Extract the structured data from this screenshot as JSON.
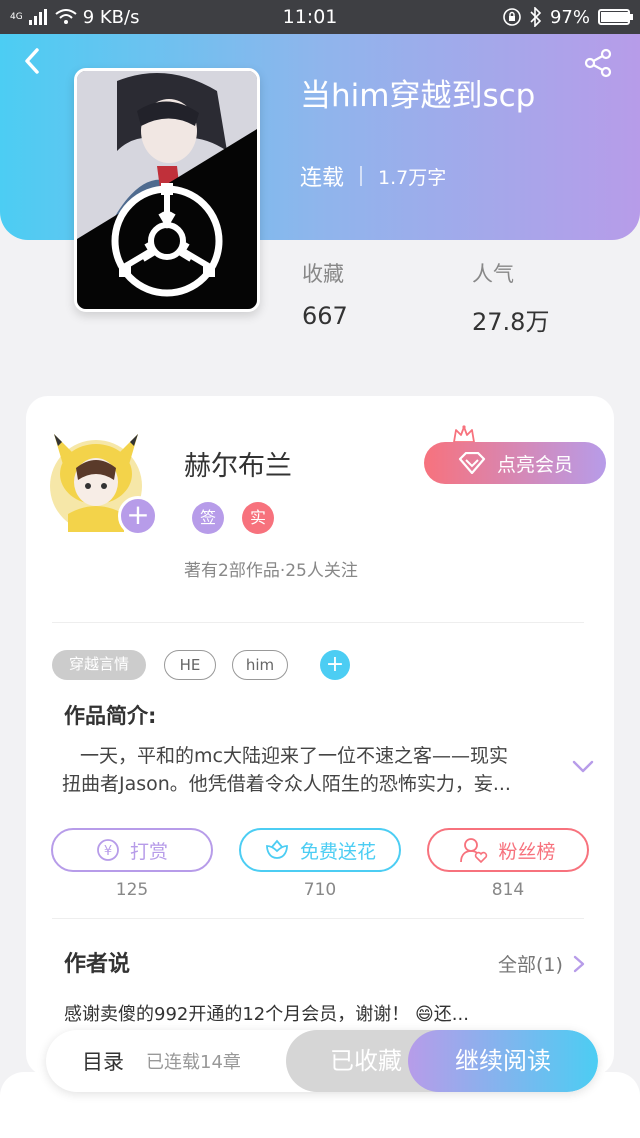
{
  "status_bar": {
    "network": "4G",
    "speed": "9 KB/s",
    "time": "11:01",
    "battery": "97%",
    "battery_level": 0.97
  },
  "book": {
    "title": "当him穿越到scp",
    "status": "连载",
    "word_count": "1.7万字"
  },
  "stats": {
    "favorites_label": "收藏",
    "favorites_value": "667",
    "popularity_label": "人气",
    "popularity_value": "27.8万"
  },
  "author": {
    "name": "赫尔布兰",
    "badge_sign": "签",
    "badge_real": "实",
    "stats": "著有2部作品·25人关注",
    "add_label": "+"
  },
  "vip_button": {
    "label": "点亮会员"
  },
  "tags": [
    "穿越言情",
    "HE",
    "him"
  ],
  "tag_add_label": "+",
  "intro": {
    "title": "作品简介:",
    "line1": "一天，平和的mc大陆迎来了一位不速之客——现实",
    "line2": "扭曲者Jason。他凭借着令众人陌生的恐怖实力，妄..."
  },
  "actions": {
    "tip": {
      "label": "打赏",
      "count": "125",
      "icon_char": "¥"
    },
    "flower": {
      "label": "免费送花",
      "count": "710"
    },
    "fans": {
      "label": "粉丝榜",
      "count": "814"
    }
  },
  "author_says": {
    "title": "作者说",
    "all_label": "全部(1)",
    "text": "感谢卖傻的992开通的12个月会员，谢谢！ 😄还..."
  },
  "bottom_bar": {
    "toc_label": "目录",
    "toc_status": "已连载14章",
    "collected_label": "已收藏",
    "continue_label": "继续阅读"
  },
  "colors": {
    "accent_cyan": "#4ccdf3",
    "accent_purple": "#b79ce9",
    "accent_pink": "#f7727d"
  }
}
